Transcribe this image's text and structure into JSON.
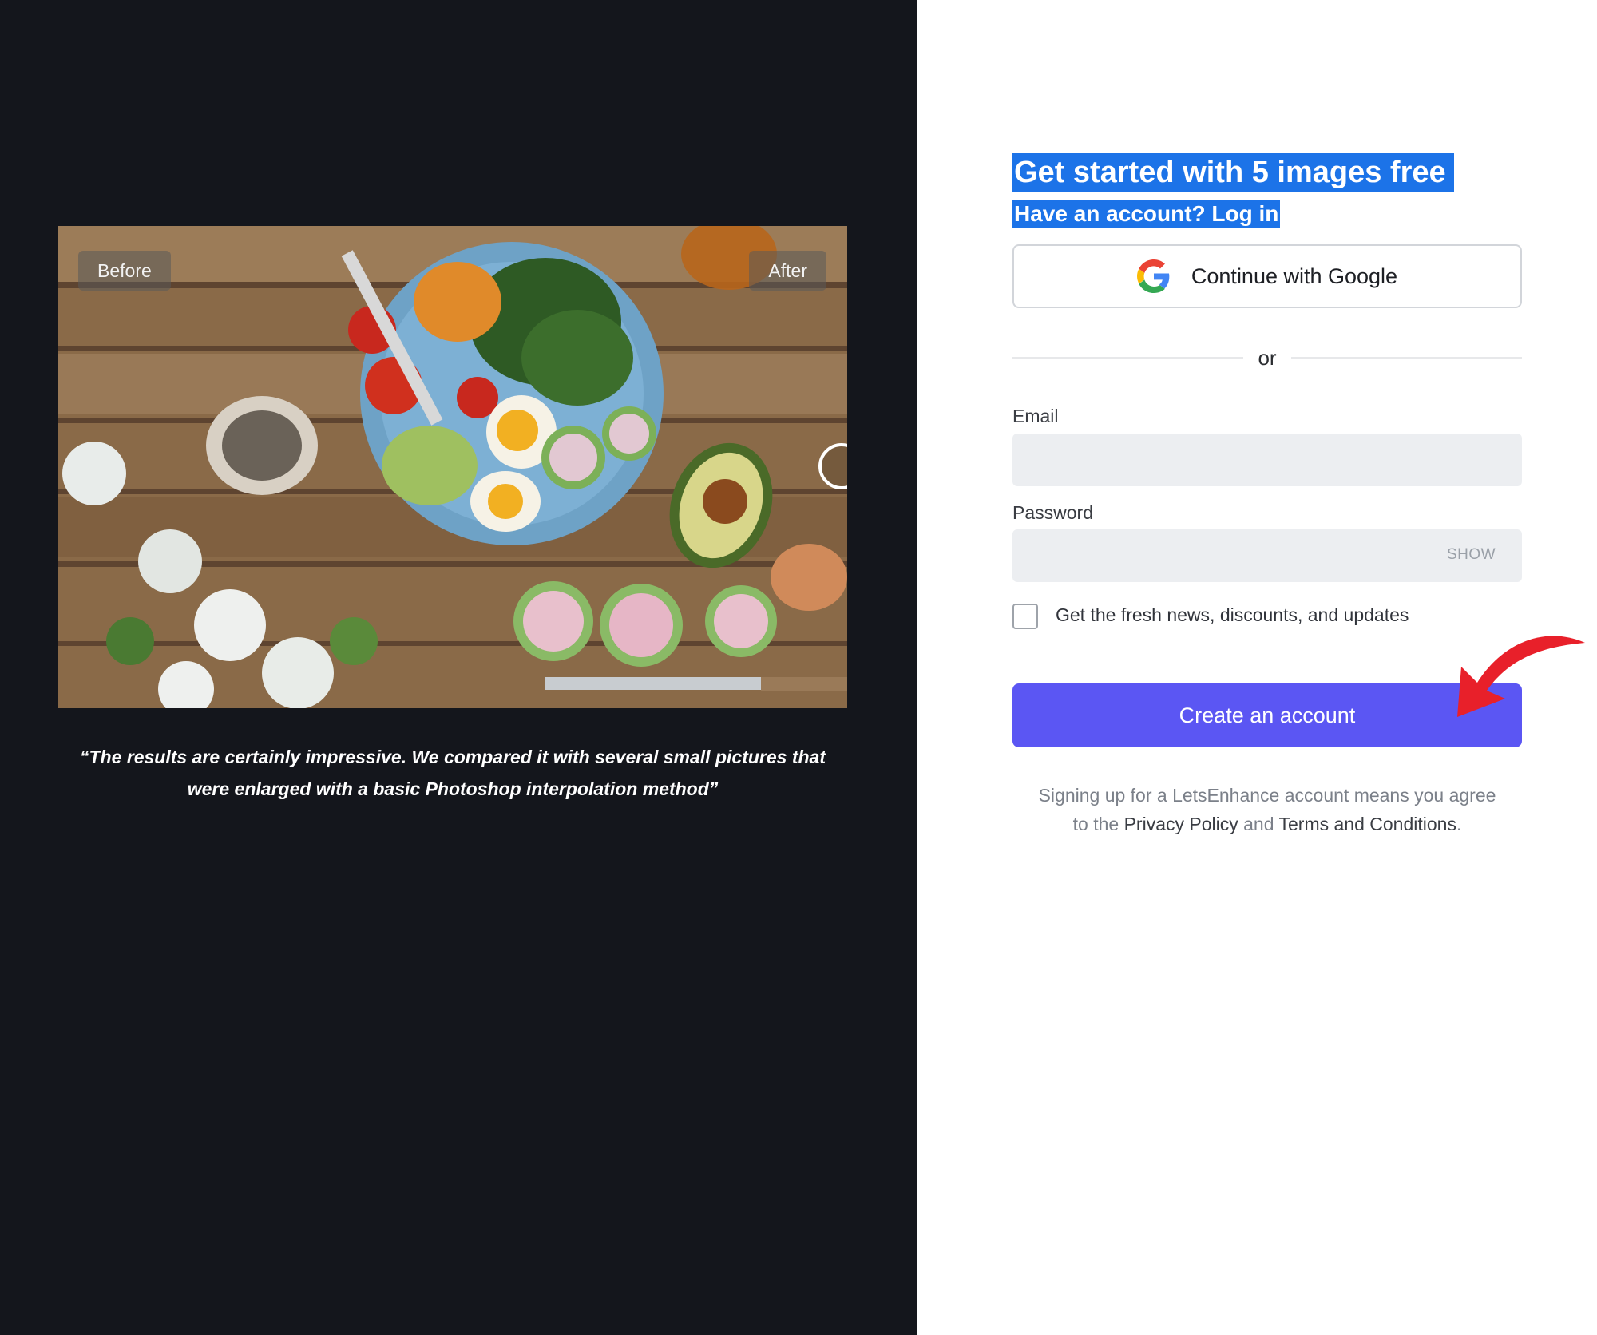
{
  "left": {
    "before_label": "Before",
    "after_label": "After",
    "quote_line1": "“The results are certainly impressive. We compared it with several small pictures that",
    "quote_line2": "were enlarged with a basic Photoshop interpolation method”"
  },
  "signup": {
    "title": "Get started with 5 images free",
    "login_prompt": "Have an account? Log in",
    "google_label": "Continue with Google",
    "divider_text": "or",
    "email_label": "Email",
    "email_value": "",
    "password_label": "Password",
    "password_value": "",
    "show_label": "SHOW",
    "newsletter_label": "Get the fresh news, discounts, and updates",
    "newsletter_checked": false,
    "create_label": "Create an account",
    "legal_prefix": "Signing up for a LetsEnhance account means you agree",
    "legal_to_the": "to the ",
    "privacy_label": "Privacy Policy",
    "legal_and": " and ",
    "terms_label": "Terms and Conditions",
    "legal_period": "."
  },
  "colors": {
    "left_bg": "#14161c",
    "highlight": "#1c73e8",
    "primary_button": "#5b56f3",
    "annotation_arrow": "#e8202a"
  },
  "icons": {
    "google": "google-g-icon",
    "slider": "slider-handle-icon",
    "annotation": "red-curved-arrow-icon"
  }
}
